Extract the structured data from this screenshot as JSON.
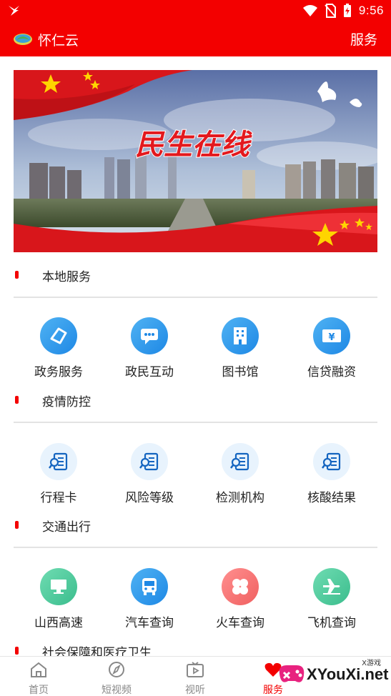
{
  "status_bar": {
    "time": "9:56"
  },
  "header": {
    "app_name": "怀仁云",
    "right_label": "服务"
  },
  "banner": {
    "slogan": "民生在线"
  },
  "sections": [
    {
      "title": "本地服务",
      "items": [
        {
          "label": "政务服务",
          "icon": "government-service-icon"
        },
        {
          "label": "政民互动",
          "icon": "chat-bubble-icon"
        },
        {
          "label": "图书馆",
          "icon": "building-icon"
        },
        {
          "label": "信贷融资",
          "icon": "money-card-icon"
        }
      ]
    },
    {
      "title": "疫情防控",
      "items": [
        {
          "label": "行程卡",
          "icon": "document-search-icon"
        },
        {
          "label": "风险等级",
          "icon": "document-search-icon"
        },
        {
          "label": "检测机构",
          "icon": "document-search-icon"
        },
        {
          "label": "核酸结果",
          "icon": "document-search-icon"
        }
      ]
    },
    {
      "title": "交通出行",
      "items": [
        {
          "label": "山西高速",
          "icon": "monitor-icon"
        },
        {
          "label": "汽车查询",
          "icon": "bus-icon"
        },
        {
          "label": "火车查询",
          "icon": "four-petal-icon"
        },
        {
          "label": "飞机查询",
          "icon": "airplane-icon"
        }
      ]
    },
    {
      "title": "社会保障和医疗卫生",
      "items": []
    }
  ],
  "bottom_nav": [
    {
      "label": "首页",
      "icon": "home-icon"
    },
    {
      "label": "短视频",
      "icon": "compass-icon"
    },
    {
      "label": "视听",
      "icon": "tv-icon"
    },
    {
      "label": "服务",
      "icon": "heart-icon",
      "active": true
    }
  ],
  "watermark": {
    "text": "XYouXi.net",
    "small": "X游戏"
  },
  "colors": {
    "brand_red": "#f30000",
    "icon_blue": "#1e88e5",
    "icon_green": "#3bbd8d",
    "icon_pink": "#f06060"
  }
}
